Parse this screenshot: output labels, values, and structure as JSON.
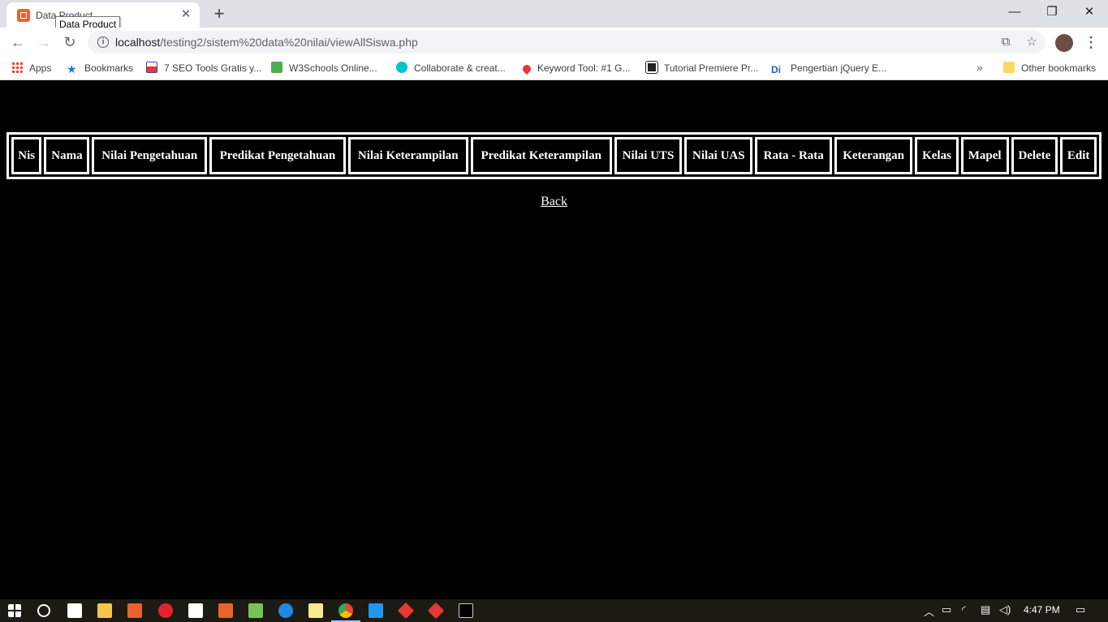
{
  "browser": {
    "tab": {
      "title": "Data Product",
      "tooltip": "Data Product",
      "close": "✕"
    },
    "new_tab": "+",
    "window": {
      "minimize": "—",
      "maximize": "❐",
      "close": "✕"
    },
    "nav": {
      "back": "←",
      "forward": "→",
      "reload": "↻"
    },
    "address": {
      "host": "localhost",
      "path": "/testing2/sistem%20data%20nilai/viewAllSiswa.php"
    },
    "menu": "⋮"
  },
  "bookmarks": {
    "items": [
      {
        "label": "Apps",
        "color": "#ea4335"
      },
      {
        "label": "Bookmarks",
        "color": "#1a73e8"
      },
      {
        "label": "7 SEO Tools Gratis y...",
        "color": "#4a5bd6"
      },
      {
        "label": "W3Schools Online...",
        "color": "#4caf50"
      },
      {
        "label": "Collaborate & creat...",
        "color": "#00c4cc"
      },
      {
        "label": "Keyword Tool: #1 G...",
        "color": "#e53935"
      },
      {
        "label": "Tutorial Premiere Pr...",
        "color": "#222222"
      },
      {
        "label": "Pengertian jQuery E...",
        "color": "#1565c0"
      }
    ],
    "overflow": "»",
    "other": "Other bookmarks"
  },
  "page": {
    "table_headers": [
      "Nis",
      "Nama",
      "Nilai Pengetahuan",
      "Predikat Pengetahuan",
      "Nilai Keterampilan",
      "Predikat Keterampilan",
      "Nilai UTS",
      "Nilai UAS",
      "Rata - Rata",
      "Keterangan",
      "Kelas",
      "Mapel",
      "Delete",
      "Edit"
    ],
    "back_link": "Back"
  },
  "taskbar": {
    "clock": "4:47 PM"
  }
}
